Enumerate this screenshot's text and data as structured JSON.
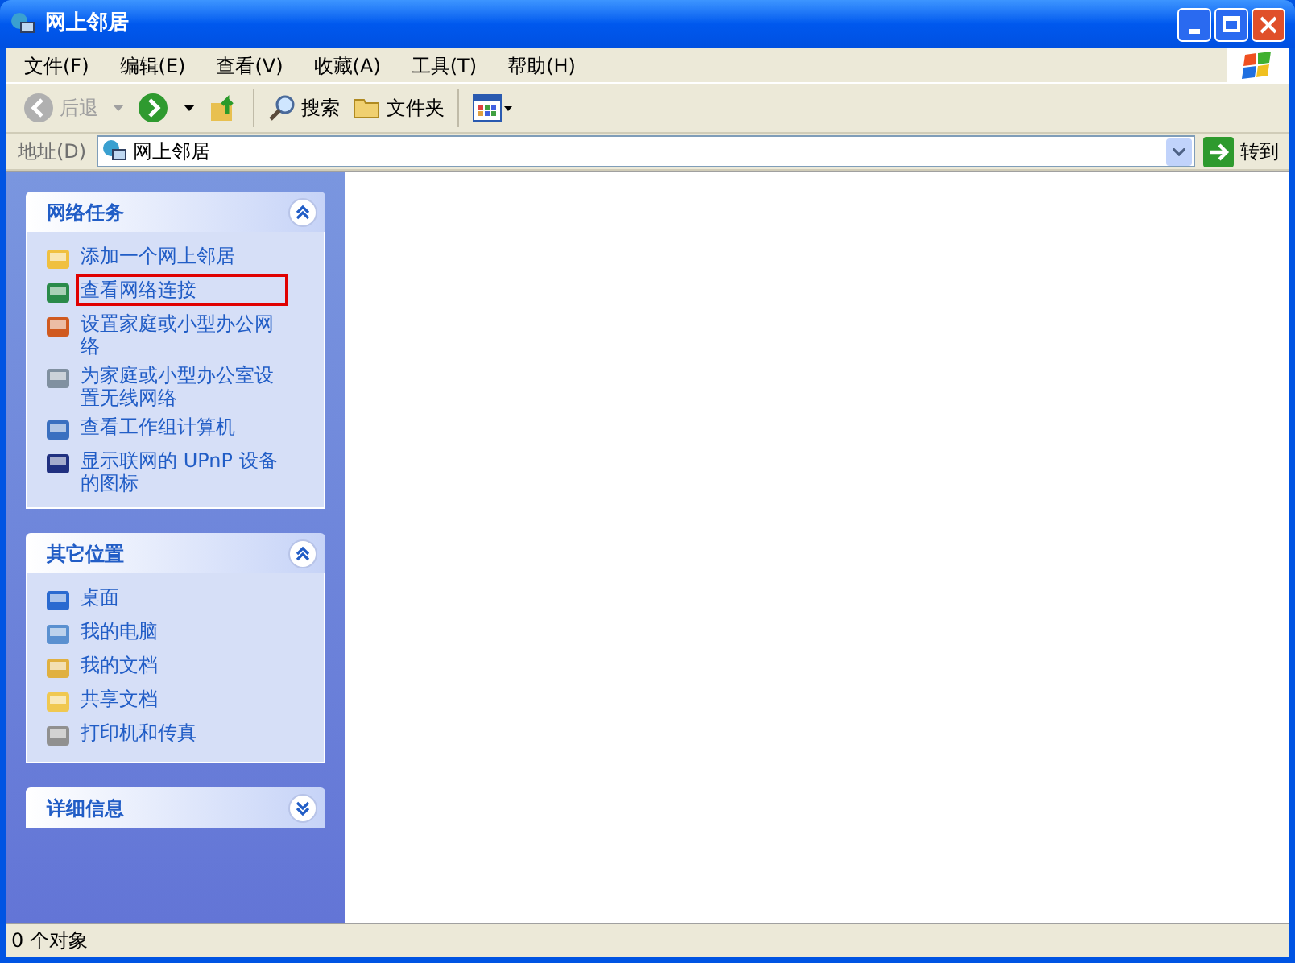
{
  "window": {
    "title": "网上邻居"
  },
  "menu": [
    "文件(F)",
    "编辑(E)",
    "查看(V)",
    "收藏(A)",
    "工具(T)",
    "帮助(H)"
  ],
  "toolbar": [
    {
      "kind": "back",
      "label": "后退",
      "disabled": true
    },
    {
      "kind": "forward",
      "disabled": false
    },
    {
      "kind": "up"
    },
    {
      "kind": "search",
      "label": "搜索"
    },
    {
      "kind": "folders",
      "label": "文件夹"
    },
    {
      "kind": "views"
    }
  ],
  "address": {
    "label": "地址(D)",
    "value": "网上邻居",
    "go": "转到"
  },
  "sidebar": [
    {
      "title": "网络任务",
      "expanded": true,
      "items": [
        {
          "label": "添加一个网上邻居",
          "highlighted": false
        },
        {
          "label": "查看网络连接",
          "highlighted": true
        },
        {
          "label": "设置家庭或小型办公网络",
          "highlighted": false
        },
        {
          "label": "为家庭或小型办公室设置无线网络",
          "highlighted": false
        },
        {
          "label": "查看工作组计算机",
          "highlighted": false
        },
        {
          "label": "显示联网的 UPnP 设备的图标",
          "highlighted": false
        }
      ]
    },
    {
      "title": "其它位置",
      "expanded": true,
      "items": [
        {
          "label": "桌面",
          "highlighted": false
        },
        {
          "label": "我的电脑",
          "highlighted": false
        },
        {
          "label": "我的文档",
          "highlighted": false
        },
        {
          "label": "共享文档",
          "highlighted": false
        },
        {
          "label": "打印机和传真",
          "highlighted": false
        }
      ]
    },
    {
      "title": "详细信息",
      "expanded": false
    }
  ],
  "status_bar": "0 个对象"
}
